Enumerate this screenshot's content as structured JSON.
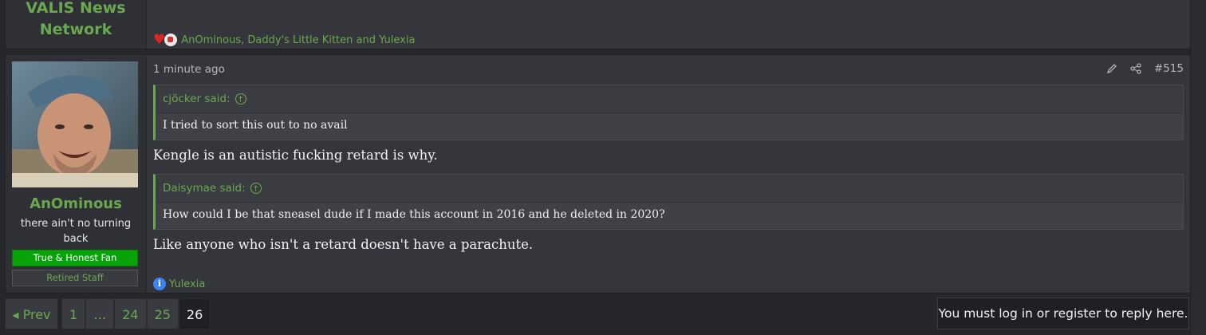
{
  "previous_post": {
    "username_lines": [
      "VALIS News",
      "Network"
    ],
    "reactions": "AnOminous, Daddy's Little Kitten and Yulexia"
  },
  "post": {
    "time": "1 minute ago",
    "post_number": "#515",
    "author": {
      "name": "AnOminous",
      "title": "there ain't no turning back",
      "banners": [
        "True & Honest Fan",
        "Retired Staff"
      ]
    },
    "quotes": [
      {
        "author": "cjöcker said:",
        "text": "I tried to sort this out to no avail"
      },
      {
        "author": "Daisymae said:",
        "text": "How could I be that sneasel dude if I made this account in 2016 and he deleted in 2020?"
      }
    ],
    "messages": [
      "Kengle is an autistic fucking retard is why.",
      "Like anyone who isn't a retard doesn't have a parachute."
    ],
    "reaction": "Yulexia"
  },
  "pagination": {
    "prev_label": "Prev",
    "pages": [
      "1",
      "…",
      "24",
      "25",
      "26"
    ],
    "current": "26"
  },
  "login_notice": "You must log in or register to reply here.",
  "colors": {
    "accent_green": "#6aa84f",
    "background": "#26272b",
    "panel": "#35363c"
  }
}
